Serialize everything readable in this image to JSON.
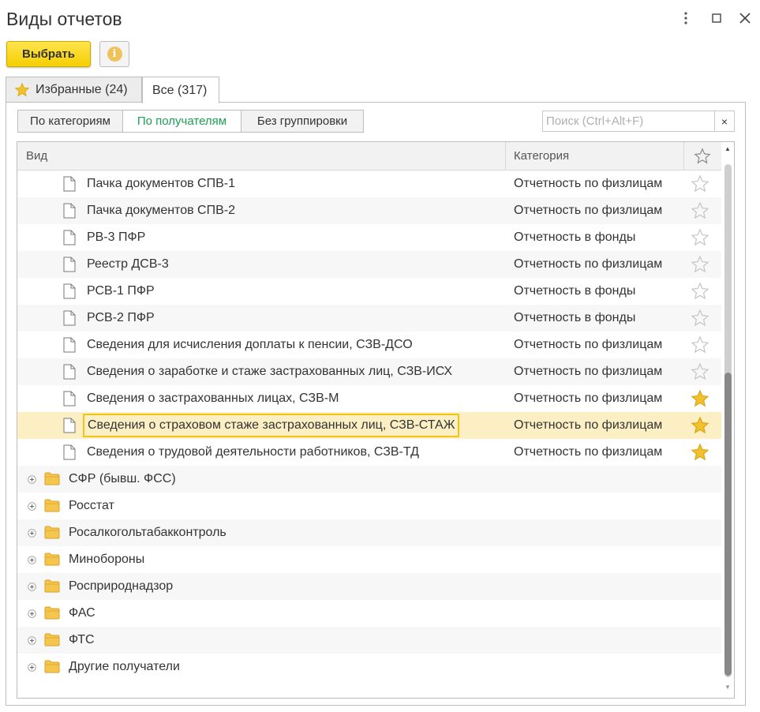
{
  "window": {
    "title": "Виды отчетов"
  },
  "toolbar": {
    "select_label": "Выбрать",
    "info_glyph": "i"
  },
  "tabs": [
    {
      "label": "Избранные (24)",
      "icon": "star-icon",
      "active": false
    },
    {
      "label": "Все (317)",
      "active": true
    }
  ],
  "grouping": {
    "buttons": [
      "По категориям",
      "По получателям",
      "Без группировки"
    ],
    "active": "По получателям"
  },
  "search": {
    "value": "",
    "placeholder": "Поиск (Ctrl+Alt+F)",
    "clear_glyph": "×"
  },
  "table": {
    "columns": {
      "name": "Вид",
      "category": "Категория",
      "favorite_icon": "star-outline-icon"
    },
    "documents": [
      {
        "name": "Пачка документов СПВ-1",
        "category": "Отчетность по физлицам",
        "favorite": false
      },
      {
        "name": "Пачка документов СПВ-2",
        "category": "Отчетность по физлицам",
        "favorite": false
      },
      {
        "name": "РВ-3 ПФР",
        "category": "Отчетность в фонды",
        "favorite": false
      },
      {
        "name": "Реестр ДСВ-3",
        "category": "Отчетность по физлицам",
        "favorite": false
      },
      {
        "name": "РСВ-1 ПФР",
        "category": "Отчетность в фонды",
        "favorite": false
      },
      {
        "name": "РСВ-2 ПФР",
        "category": "Отчетность в фонды",
        "favorite": false
      },
      {
        "name": "Сведения для исчисления доплаты к пенсии, СЗВ-ДСО",
        "category": "Отчетность по физлицам",
        "favorite": false
      },
      {
        "name": "Сведения о заработке и стаже застрахованных лиц, СЗВ-ИСХ",
        "category": "Отчетность по физлицам",
        "favorite": false
      },
      {
        "name": "Сведения о застрахованных лицах, СЗВ-М",
        "category": "Отчетность по физлицам",
        "favorite": true
      },
      {
        "name": "Сведения о страховом стаже застрахованных лиц, СЗВ-СТАЖ",
        "category": "Отчетность по физлицам",
        "favorite": true,
        "selected": true
      },
      {
        "name": "Сведения о трудовой деятельности работников, СЗВ-ТД",
        "category": "Отчетность по физлицам",
        "favorite": true
      }
    ],
    "groups": [
      "СФР (бывш. ФСС)",
      "Росстат",
      "Росалкогольтабакконтроль",
      "Минобороны",
      "Росприроднадзор",
      "ФАС",
      "ФТС",
      "Другие получатели"
    ]
  },
  "colors": {
    "accent_yellow": "#f5cf00",
    "selected_row": "#fcefc3",
    "focus_border": "#f0c419",
    "active_group_text": "#1f9d55",
    "star_filled": "#f2c12e",
    "folder": "#f5c64f"
  }
}
